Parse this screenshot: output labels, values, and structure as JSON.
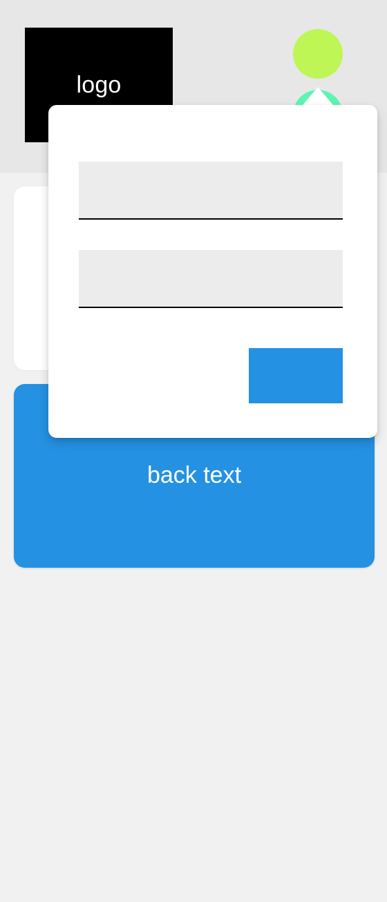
{
  "header": {
    "logo_text": "logo"
  },
  "back_card": {
    "text": "back text"
  },
  "popover": {
    "field_1": {
      "value": "",
      "placeholder": ""
    },
    "field_2": {
      "value": "",
      "placeholder": ""
    },
    "submit_label": ""
  },
  "colors": {
    "header_bg": "#e7e7e7",
    "page_bg": "#f1f1f1",
    "logo_bg": "#000000",
    "avatar_primary": "#bef656",
    "avatar_secondary": "#5cf5b3",
    "accent_blue": "#2491e2",
    "field_bg": "#ececec"
  }
}
